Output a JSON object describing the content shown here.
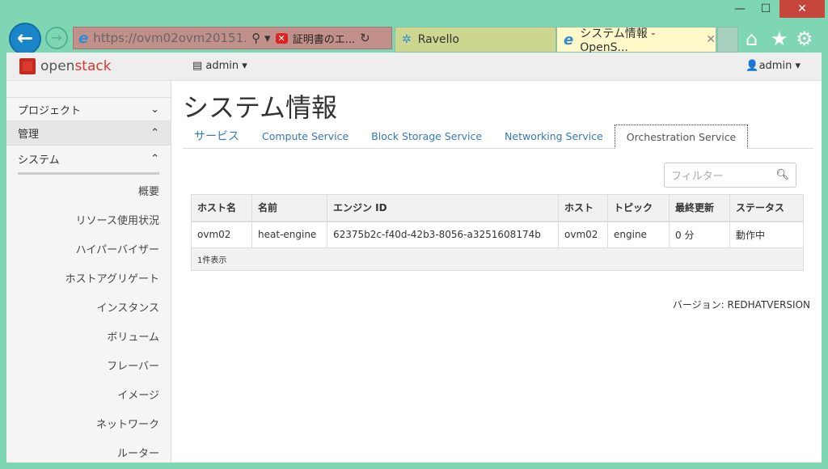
{
  "window": {
    "minimize": "—",
    "maximize": "☐",
    "close": "✕"
  },
  "browser": {
    "url": "https://ovm02ovm20151...",
    "cert_error": "証明書のエ...",
    "tabs": [
      {
        "label": "Ravello"
      },
      {
        "label": "システム情報 - OpenS...",
        "active": true
      }
    ],
    "address_bar_color": "#c2908a"
  },
  "header": {
    "brand_open": "open",
    "brand_stack": "stack",
    "project": "admin",
    "user": "admin"
  },
  "sidebar": {
    "sections": [
      {
        "label": "プロジェクト"
      },
      {
        "label": "管理"
      },
      {
        "label": "システム"
      }
    ],
    "items": [
      "概要",
      "リソース使用状況",
      "ハイパーバイザー",
      "ホストアグリゲート",
      "インスタンス",
      "ボリューム",
      "フレーバー",
      "イメージ",
      "ネットワーク",
      "ルーター"
    ]
  },
  "main": {
    "title": "システム情報",
    "tabs": [
      {
        "label": "サービス"
      },
      {
        "label": "Compute Service"
      },
      {
        "label": "Block Storage Service"
      },
      {
        "label": "Networking Service"
      },
      {
        "label": "Orchestration Service",
        "active": true
      }
    ],
    "filter_placeholder": "フィルター",
    "table": {
      "headers": [
        "ホスト名",
        "名前",
        "エンジン ID",
        "ホスト",
        "トピック",
        "最終更新",
        "ステータス"
      ],
      "rows": [
        [
          "ovm02",
          "heat-engine",
          "62375b2c-f40d-42b3-8056-a3251608174b",
          "ovm02",
          "engine",
          "0 分",
          "動作中"
        ]
      ],
      "footer": "1件表示"
    },
    "version": "バージョン: REDHATVERSION"
  }
}
